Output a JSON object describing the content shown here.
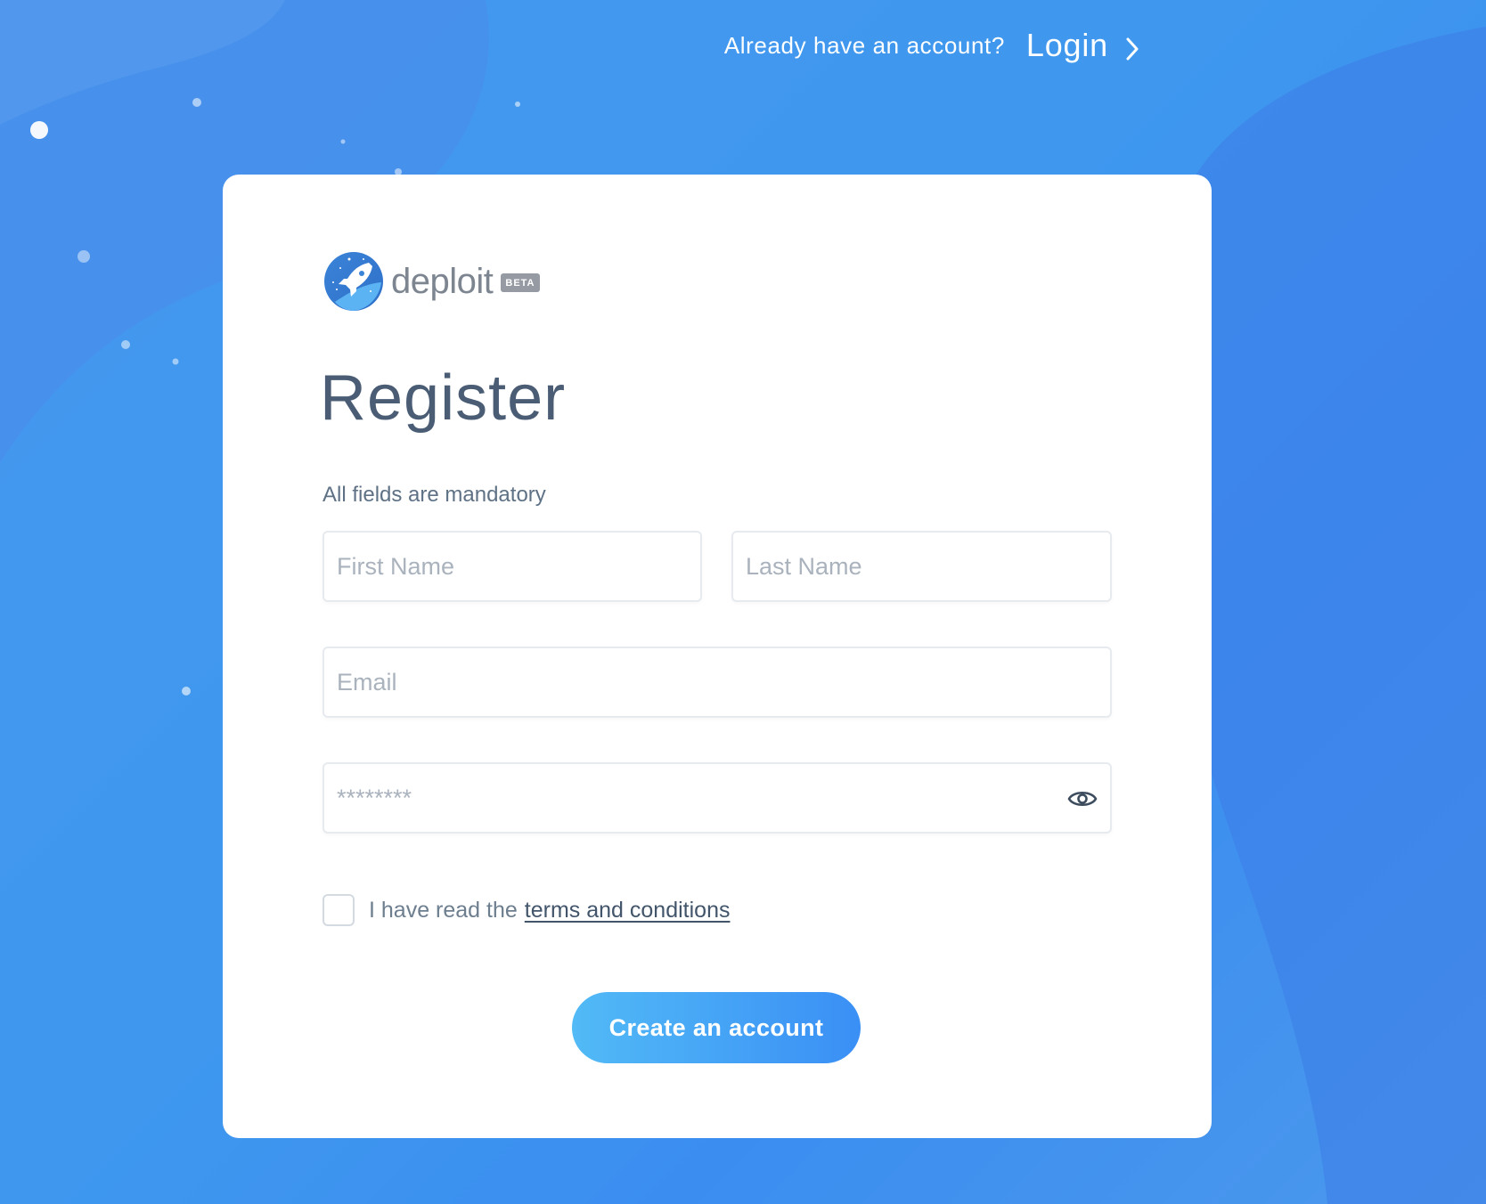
{
  "header": {
    "account_prompt": "Already have an account?",
    "login_label": "Login"
  },
  "brand": {
    "name": "deploit",
    "badge": "BETA"
  },
  "form": {
    "title": "Register",
    "subtitle": "All fields are mandatory",
    "first_name": {
      "placeholder": "First Name",
      "value": ""
    },
    "last_name": {
      "placeholder": "Last Name",
      "value": ""
    },
    "email": {
      "placeholder": "Email",
      "value": ""
    },
    "password": {
      "placeholder": "********",
      "value": ""
    },
    "terms": {
      "checked": false,
      "text": "I have read the",
      "link": "terms and conditions"
    },
    "submit_label": "Create an account"
  },
  "colors": {
    "background": "#3f98ee",
    "accent_gradient_start": "#52baf6",
    "accent_gradient_end": "#3a8ff5",
    "title_text": "#4a5d75"
  },
  "icons": [
    "chevron-right-icon",
    "rocket-logo-icon",
    "eye-icon"
  ]
}
